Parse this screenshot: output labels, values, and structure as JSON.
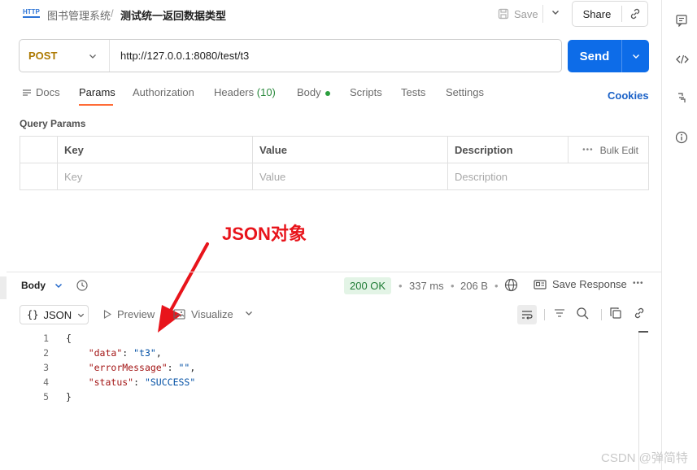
{
  "header": {
    "method_badge": "HTTP",
    "breadcrumb_parent": "图书管理系统",
    "breadcrumb_sep": "/",
    "breadcrumb_current": "测试统一返回数据类型",
    "save_label": "Save",
    "share_label": "Share"
  },
  "request": {
    "method": "POST",
    "url": "http://127.0.0.1:8080/test/t3",
    "send_label": "Send"
  },
  "tabs": [
    {
      "label": "Docs"
    },
    {
      "label": "Params",
      "active": true
    },
    {
      "label": "Authorization"
    },
    {
      "label": "Headers",
      "count": "(10)"
    },
    {
      "label": "Body",
      "dot": true
    },
    {
      "label": "Scripts"
    },
    {
      "label": "Tests"
    },
    {
      "label": "Settings"
    }
  ],
  "cookies_label": "Cookies",
  "query_params": {
    "title": "Query Params",
    "columns": [
      "Key",
      "Value",
      "Description"
    ],
    "bulk_edit": "Bulk Edit",
    "placeholders": [
      "Key",
      "Value",
      "Description"
    ]
  },
  "annotation": "JSON对象",
  "response": {
    "body_label": "Body",
    "status": "200 OK",
    "time": "337 ms",
    "size": "206 B",
    "save_response": "Save Response",
    "format": "JSON",
    "preview": "Preview",
    "visualize": "Visualize",
    "lines": [
      {
        "n": "1",
        "text": "{"
      },
      {
        "n": "2",
        "key": "\"data\"",
        "value": "\"t3\"",
        "trail": ","
      },
      {
        "n": "3",
        "key": "\"errorMessage\"",
        "value": "\"\"",
        "trail": ","
      },
      {
        "n": "4",
        "key": "\"status\"",
        "value": "\"SUCCESS\"",
        "trail": ""
      },
      {
        "n": "5",
        "text": "}"
      }
    ]
  },
  "watermark": "CSDN @弹简特",
  "colors": {
    "accent_orange": "#ff6c37",
    "send_blue": "#0d6ce8",
    "annotation_red": "#e8141b",
    "status_green": "#1e7b34"
  }
}
